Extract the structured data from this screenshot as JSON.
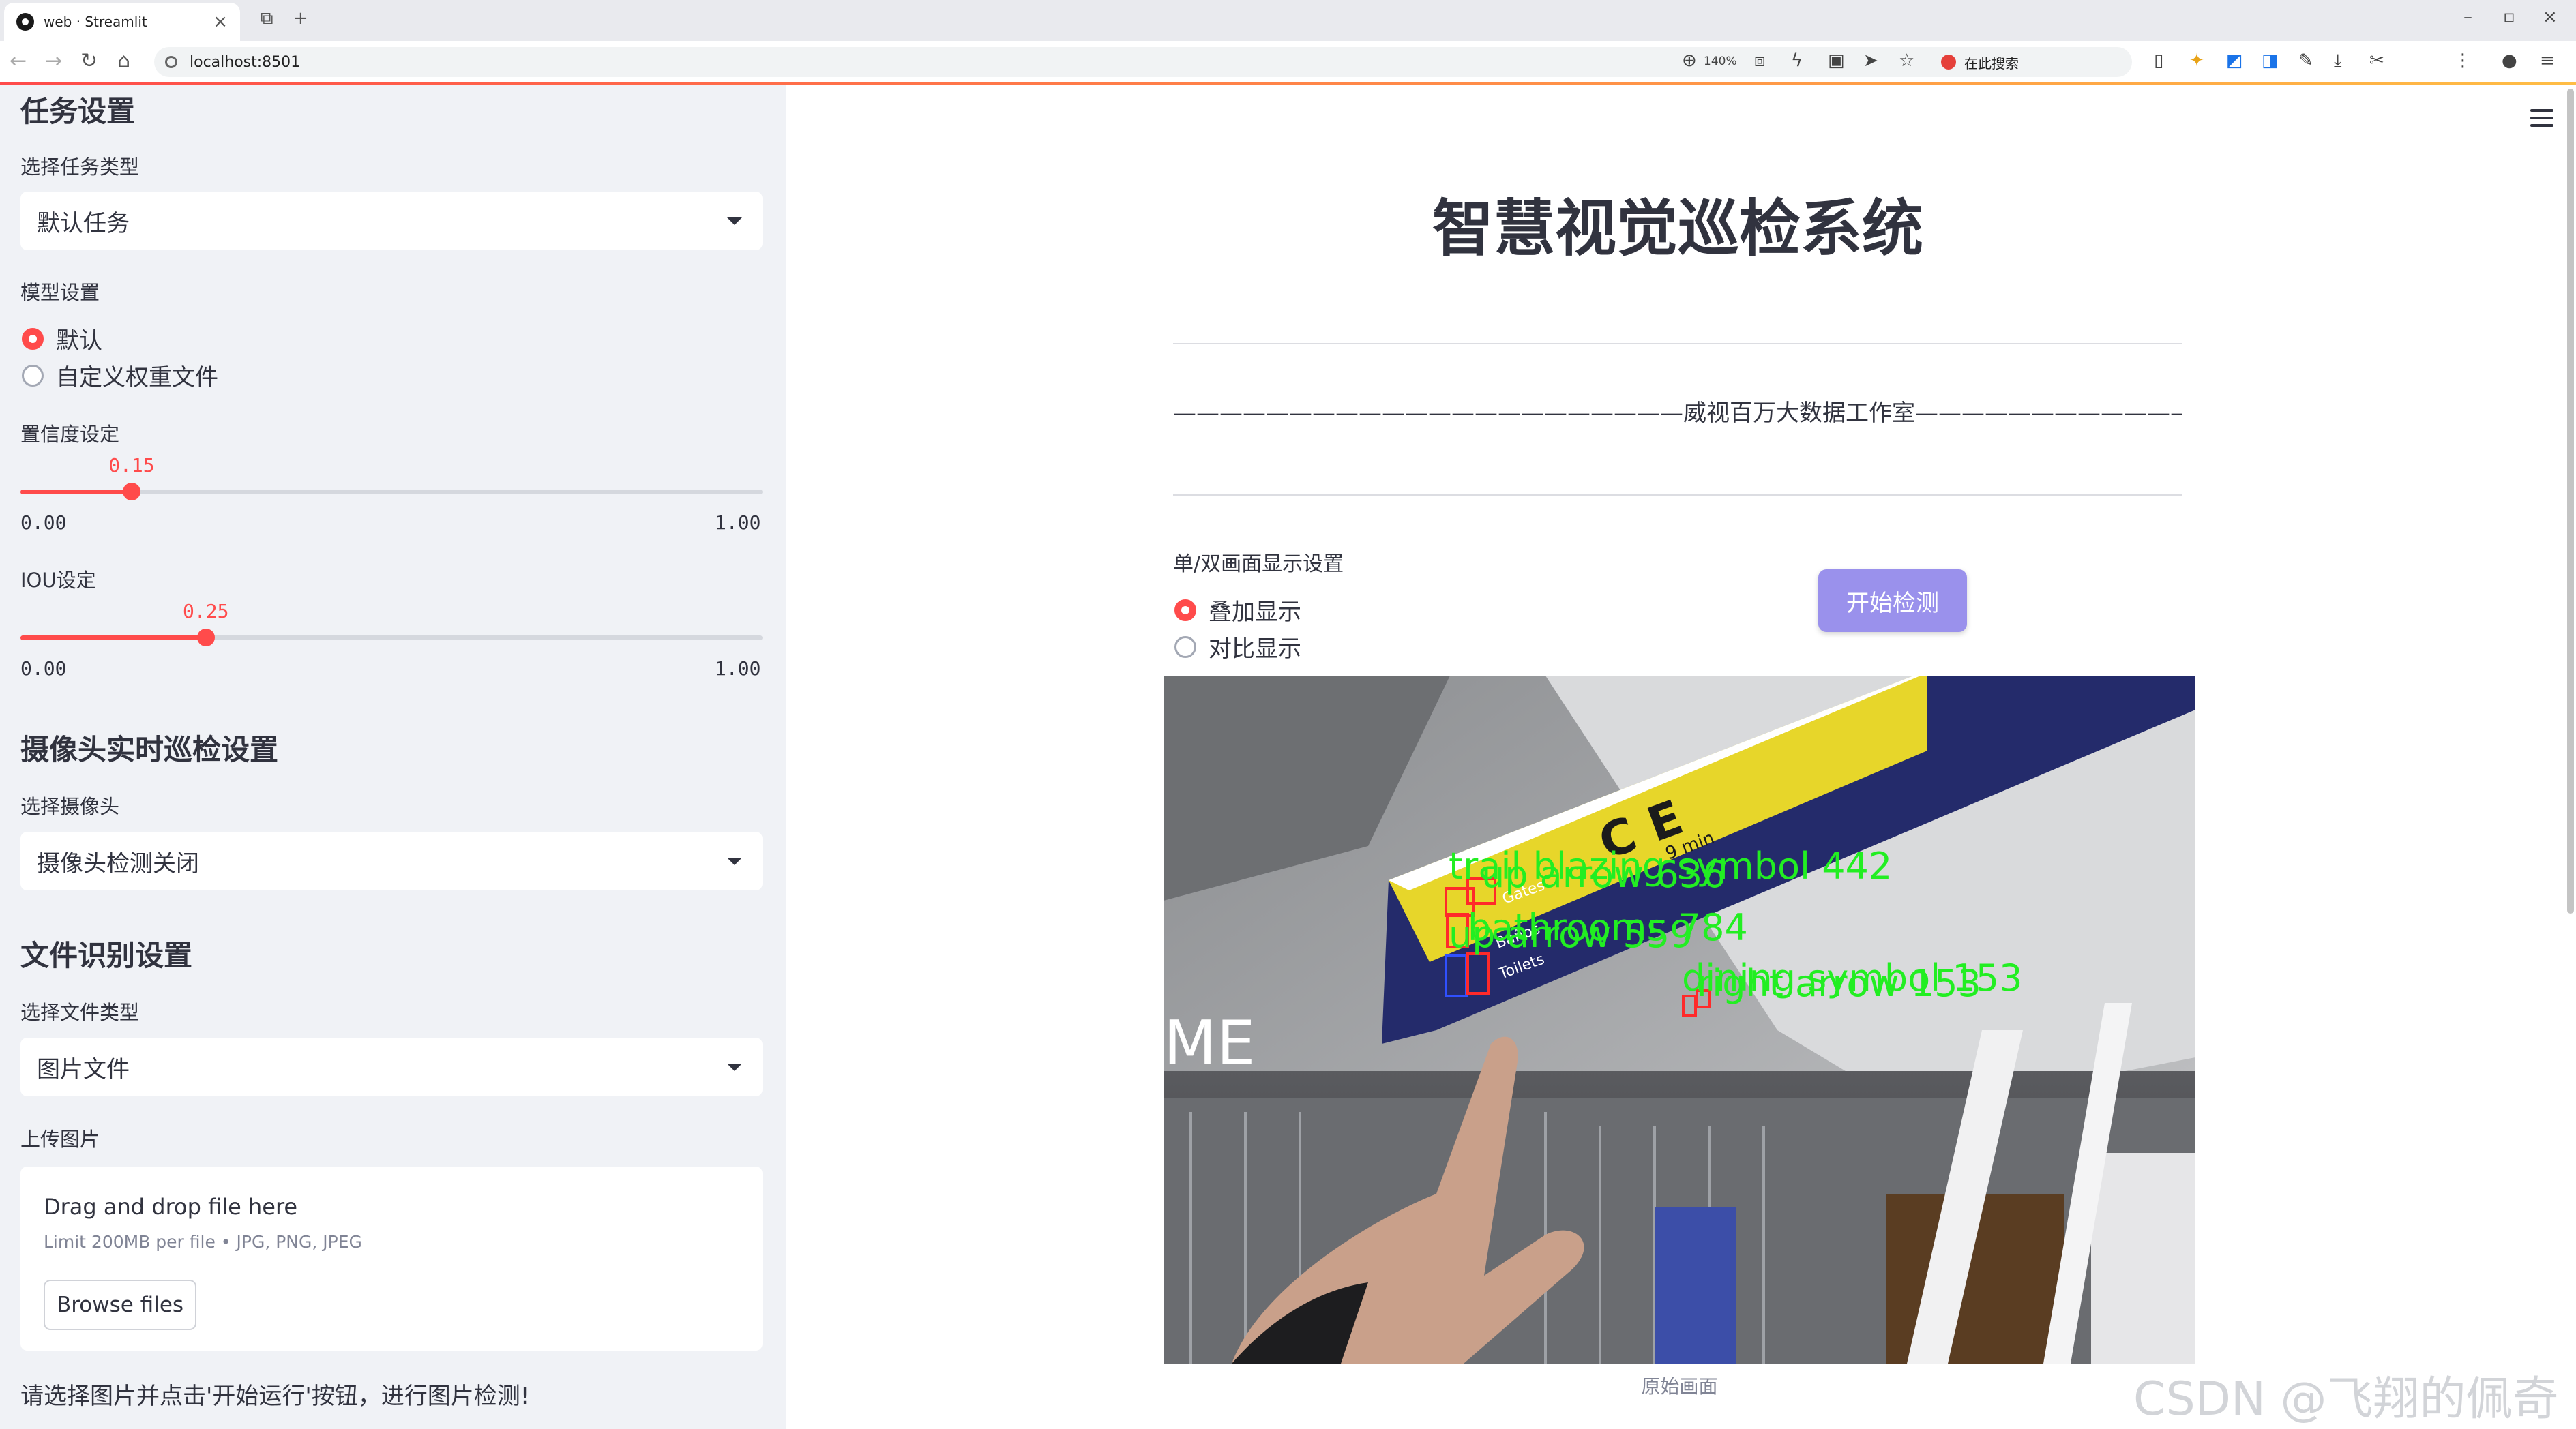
{
  "browser": {
    "tab_title": "web · Streamlit",
    "url": "localhost:8501",
    "zoom": "140%",
    "search_label": "在此搜索"
  },
  "sidebar": {
    "task_heading": "任务设置",
    "task_type_label": "选择任务类型",
    "task_type_value": "默认任务",
    "model_label": "模型设置",
    "model_options": [
      "默认",
      "自定义权重文件"
    ],
    "model_selected": 0,
    "conf_label": "置信度设定",
    "conf": {
      "value": 0.15,
      "value_text": "0.15",
      "min": "0.00",
      "max": "1.00"
    },
    "iou_label": "IOU设定",
    "iou": {
      "value": 0.25,
      "value_text": "0.25",
      "min": "0.00",
      "max": "1.00"
    },
    "camera_heading": "摄像头实时巡检设置",
    "camera_label": "选择摄像头",
    "camera_value": "摄像头检测关闭",
    "file_heading": "文件识别设置",
    "file_type_label": "选择文件类型",
    "file_type_value": "图片文件",
    "upload_label": "上传图片",
    "upload_title": "Drag and drop file here",
    "upload_limit": "Limit 200MB per file • JPG, PNG, JPEG",
    "browse_label": "Browse files",
    "note": "请选择图片并点击'开始运行'按钮，进行图片检测!"
  },
  "main": {
    "title": "智慧视觉巡检系统",
    "studio_line": "——————————————————————威视百万大数据工作室——————————————————————",
    "display_label": "单/双画面显示设置",
    "display_options": [
      "叠加显示",
      "对比显示"
    ],
    "display_selected": 0,
    "start_button": "开始检测",
    "image_caption": "原始画面",
    "sign_text": {
      "letters": "C E",
      "min": "9 min",
      "gates": "Gates",
      "banos": "Baños",
      "toilets": "Toilets",
      "me": "ME"
    },
    "detections": [
      "trail blazing symbol 442",
      "up arrow 636",
      "bathrooms 784",
      "up arrow 559",
      "dining symbol 153",
      "right arrow 153"
    ],
    "watermark": "CSDN @飞翔的佩奇"
  },
  "colors": {
    "accent": "#ff4b4b",
    "button": "#9a91ec",
    "sidebar_bg": "#f0f2f6",
    "detect_text": "#22ee22"
  }
}
